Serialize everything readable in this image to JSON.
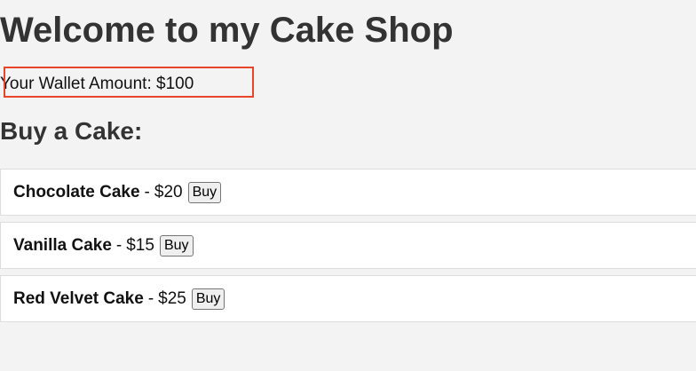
{
  "page": {
    "title": "Welcome to my Cake Shop"
  },
  "wallet": {
    "label": "Your Wallet Amount: $100"
  },
  "section": {
    "title": "Buy a Cake:"
  },
  "cakes": [
    {
      "name": "Chocolate Cake",
      "separator": "-",
      "price": "$20",
      "buy_label": "Buy"
    },
    {
      "name": "Vanilla Cake",
      "separator": "-",
      "price": "$15",
      "buy_label": "Buy"
    },
    {
      "name": "Red Velvet Cake",
      "separator": "-",
      "price": "$25",
      "buy_label": "Buy"
    }
  ],
  "colors": {
    "background": "#f3f3f3",
    "highlight_border": "#e8452a",
    "item_background": "#ffffff"
  }
}
